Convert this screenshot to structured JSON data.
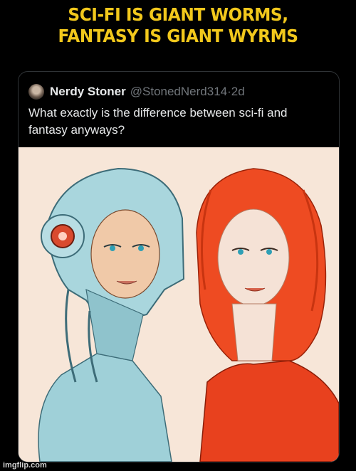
{
  "meme": {
    "caption_line1": "SCI-FI IS GIANT WORMS,",
    "caption_line2": "FANTASY IS GIANT WYRMS"
  },
  "tweet": {
    "author_name": "Nerdy Stoner",
    "author_handle": "@StonedNerd314",
    "separator": "·",
    "age": "2d",
    "text": "What exactly is the difference between sci-fi and fantasy anyways?"
  },
  "watermark": "imgflip.com",
  "colors": {
    "caption": "#f2c81c",
    "scifi_figure": "#9fd0d8",
    "fantasy_figure": "#e8411e",
    "art_background": "#f7e6d8"
  }
}
